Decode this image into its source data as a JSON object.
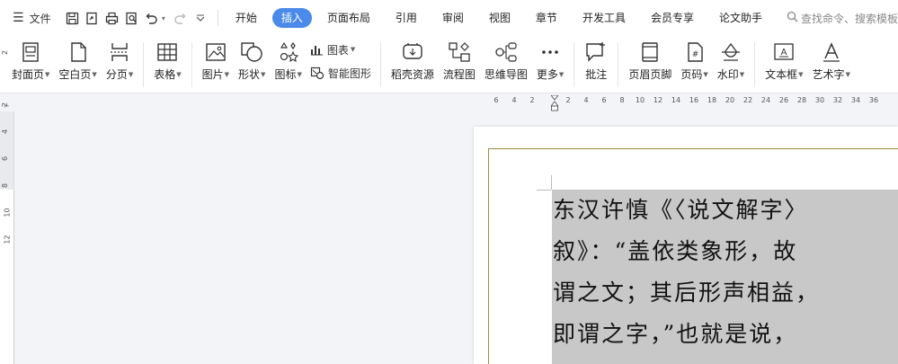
{
  "menubar": {
    "file_label": "文件",
    "tabs": [
      {
        "label": "开始",
        "active": false
      },
      {
        "label": "插入",
        "active": true
      },
      {
        "label": "页面布局",
        "active": false
      },
      {
        "label": "引用",
        "active": false
      },
      {
        "label": "审阅",
        "active": false
      },
      {
        "label": "视图",
        "active": false
      },
      {
        "label": "章节",
        "active": false
      },
      {
        "label": "开发工具",
        "active": false
      },
      {
        "label": "会员专享",
        "active": false
      },
      {
        "label": "论文助手",
        "active": false
      }
    ],
    "search_text": "查找命令、搜索模板",
    "accent_color": "#4a8ae8"
  },
  "ribbon": {
    "cover_page": "封面页",
    "blank_page": "空白页",
    "page_break": "分页",
    "table": "表格",
    "picture": "图片",
    "shape": "形状",
    "icon": "图标",
    "chart": "图表",
    "smart_art": "智能图形",
    "docer_resources": "稻壳资源",
    "flowchart": "流程图",
    "mind_map": "思维导图",
    "more": "更多",
    "comment": "批注",
    "header_footer": "页眉页脚",
    "page_number": "页码",
    "watermark": "水印",
    "text_box": "文本框",
    "word_art": "艺术字"
  },
  "ruler": {
    "ticks": [
      "6",
      "4",
      "2",
      "2",
      "4",
      "6",
      "8",
      "10",
      "12",
      "14",
      "16",
      "18",
      "20",
      "22",
      "24",
      "26",
      "28",
      "30",
      "32",
      "34",
      "36"
    ],
    "vticks": [
      "2",
      "2",
      "4",
      "6",
      "8",
      "10",
      "12"
    ]
  },
  "document": {
    "lines": [
      "东汉许慎《〈说文解字〉",
      "叙》：“盖依类象形，故",
      "谓之文；其后形声相益，",
      "即谓之字，”也就是说，"
    ]
  }
}
